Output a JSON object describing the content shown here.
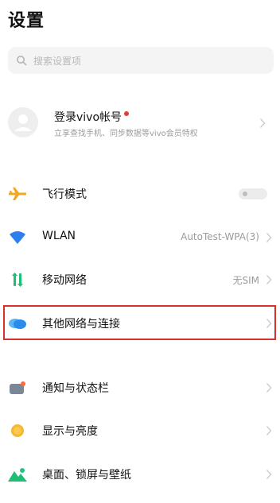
{
  "header": {
    "title": "设置"
  },
  "search": {
    "placeholder": "搜索设置项",
    "icon": "search-icon"
  },
  "account": {
    "title": "登录vivo帐号",
    "subtitle": "立享查找手机、同步数据等vivo会员特权",
    "badge_color": "#e83a3a"
  },
  "network_items": [
    {
      "label": "飞行模式",
      "icon": "airplane-icon",
      "control": "toggle",
      "toggle_on": false
    },
    {
      "label": "WLAN",
      "icon": "wifi-icon",
      "value": "AutoTest-WPA(3)"
    },
    {
      "label": "移动网络",
      "icon": "mobile-network-icon",
      "value": "无SIM"
    },
    {
      "label": "其他网络与连接",
      "icon": "connection-icon",
      "highlighted": true
    }
  ],
  "general_items": [
    {
      "label": "通知与状态栏",
      "icon": "notification-icon"
    },
    {
      "label": "显示与亮度",
      "icon": "brightness-icon"
    },
    {
      "label": "桌面、锁屏与壁纸",
      "icon": "wallpaper-icon"
    }
  ],
  "colors": {
    "highlight_border": "#d9302c",
    "airplane": "#f5a623",
    "wifi": "#2d7ff0",
    "mobile": "#1dbf73"
  }
}
